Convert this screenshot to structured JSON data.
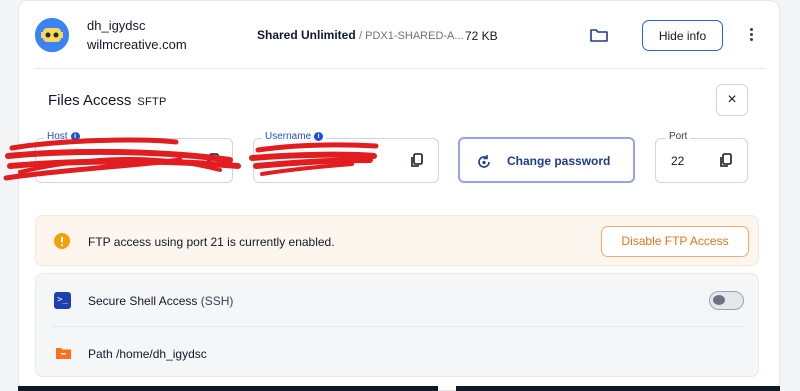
{
  "account": {
    "name": "dh_igydsc",
    "domain": "wilmcreative.com",
    "plan": "Shared Unlimited",
    "server": "/ PDX1-SHARED-A...",
    "size": "72 KB",
    "hide_info_label": "Hide info"
  },
  "files_access": {
    "title": "Files Access",
    "protocol": "SFTP",
    "close_label": "×",
    "host": {
      "label": "Host",
      "value": ""
    },
    "username": {
      "label": "Username",
      "value": ""
    },
    "change_password_label": "Change password",
    "port": {
      "label": "Port",
      "value": "22"
    }
  },
  "ftp_banner": {
    "message": "FTP access using port 21 is currently enabled.",
    "disable_label": "Disable FTP Access"
  },
  "ssh": {
    "label": "Secure Shell Access",
    "suffix": "(SSH)",
    "enabled": false,
    "path_label": "Path",
    "path_value": "/home/dh_igydsc"
  },
  "colors": {
    "accent": "#2563eb",
    "warning": "#f59e0b",
    "ftp_button": "#e0751b",
    "ssh_icon": "#1e40af",
    "folder_icon": "#f97316"
  },
  "icons": {
    "folder": "folder-icon",
    "more": "kebab-menu-icon",
    "copy": "copy-icon",
    "reset": "reset-password-icon",
    "warning": "warning-icon",
    "terminal": "terminal-icon",
    "path": "folder-path-icon"
  }
}
